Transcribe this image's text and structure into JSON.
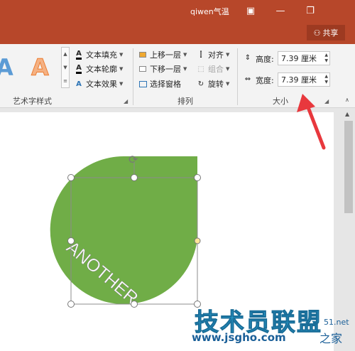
{
  "window": {
    "title": "qiwen气温",
    "share_label": "共享",
    "minimize_icon": "minimize-icon",
    "restore_icon": "restore-icon",
    "ribbon_display_icon": "ribbon-display-options-icon"
  },
  "ribbon": {
    "wordart_group": {
      "label": "艺术字样式",
      "text_fill": "文本填充",
      "text_outline": "文本轮廓",
      "text_effects": "文本效果",
      "gallery_samples": [
        "A",
        "A"
      ]
    },
    "arrange_group": {
      "label": "排列",
      "bring_forward": "上移一层",
      "send_backward": "下移一层",
      "selection_pane": "选择窗格",
      "align": "对齐",
      "group": "组合",
      "rotate": "旋转"
    },
    "size_group": {
      "label": "大小",
      "height_label": "高度:",
      "height_value": "7.39 厘米",
      "width_label": "宽度:",
      "width_value": "7.39 厘米"
    }
  },
  "slide": {
    "shape_text": "ANOTHER",
    "shape_color": "#70ad47"
  },
  "watermark": {
    "main": "技术员联盟",
    "url": "www.jsgho.com",
    "side": "之家",
    "side_small": "51.net"
  },
  "colors": {
    "titlebar": "#b7472a",
    "annotation_arrow": "#e8383d"
  }
}
